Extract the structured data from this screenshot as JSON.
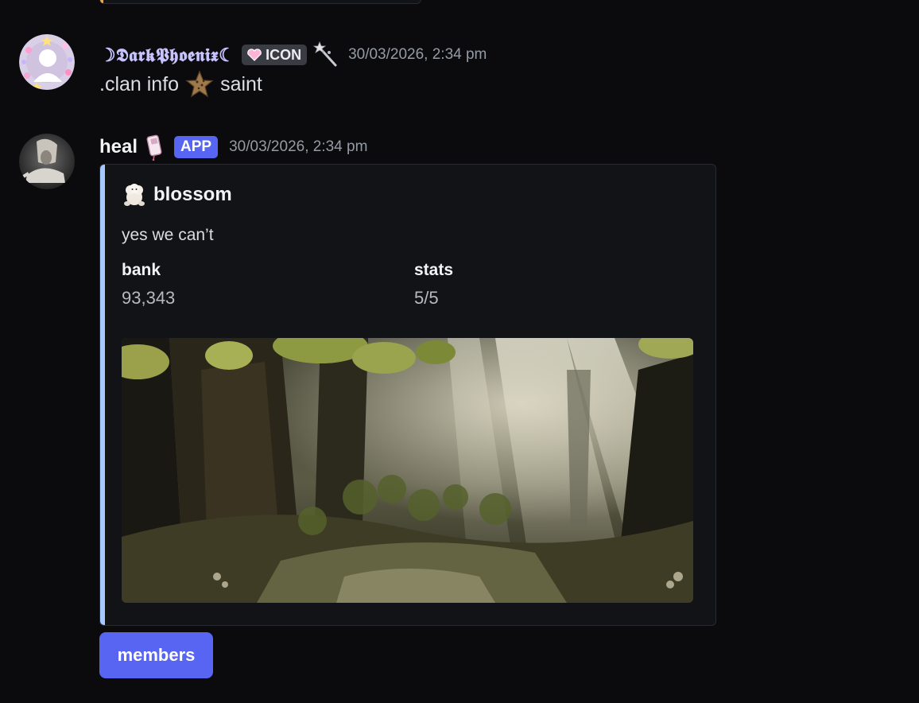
{
  "messages": [
    {
      "username": "☽𝕯𝖆𝖗𝖐𝕻𝖍𝖔𝖊𝖓𝖎𝖝☾",
      "role_tag": "ICON",
      "timestamp": "30/03/2026, 2:34 pm",
      "content_before": ".clan info",
      "content_after": "saint"
    },
    {
      "username": "heal",
      "badge": "APP",
      "timestamp": "30/03/2026, 2:34 pm",
      "embed": {
        "author": "blossom",
        "description": "yes we can’t",
        "fields": [
          {
            "name": "bank",
            "value": "93,343"
          },
          {
            "name": "stats",
            "value": "5/5"
          }
        ],
        "accent_color": "#a4c8ff"
      },
      "button_label": "members"
    }
  ],
  "colors": {
    "background": "#0b0b0e",
    "embed_bg": "#121317",
    "blurple": "#5865f2",
    "timestamp": "#949ba4"
  },
  "icons": [
    "avatar-darkphoenix",
    "heart-icon",
    "wand-icon",
    "star-icon",
    "avatar-heal",
    "phone-icon",
    "lamb-icon"
  ]
}
